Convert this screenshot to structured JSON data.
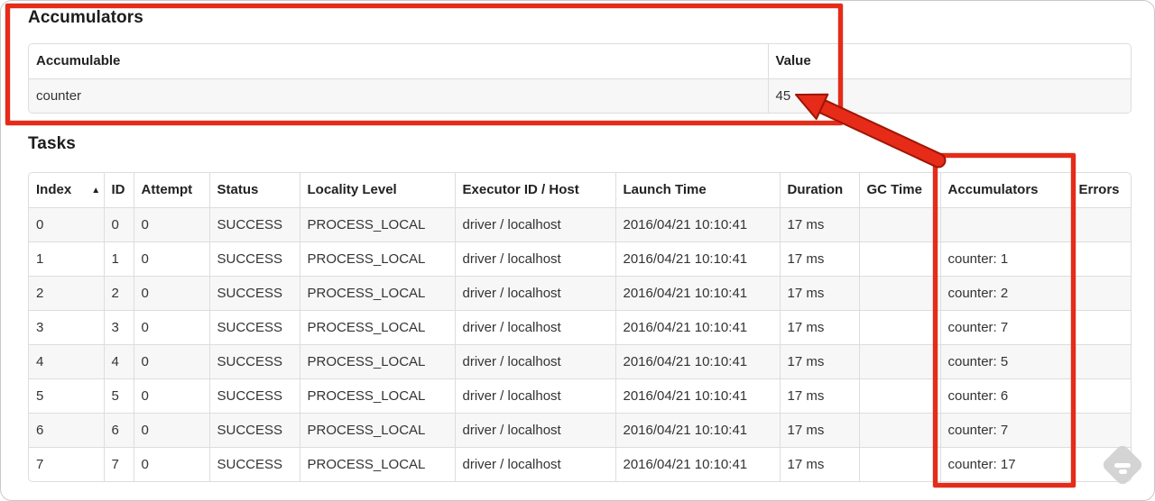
{
  "colors": {
    "annotation_red": "#e62b18",
    "row_stripe": "#f7f7f7",
    "table_border": "#dddddd"
  },
  "accumulators_section": {
    "title": "Accumulators",
    "table": {
      "headers": [
        "Accumulable",
        "Value"
      ],
      "rows": [
        [
          "counter",
          "45"
        ]
      ]
    }
  },
  "tasks_section": {
    "title": "Tasks",
    "sort_indicator": "▲",
    "table": {
      "headers": [
        "Index",
        "ID",
        "Attempt",
        "Status",
        "Locality Level",
        "Executor ID / Host",
        "Launch Time",
        "Duration",
        "GC Time",
        "Accumulators",
        "Errors"
      ],
      "rows": [
        [
          "0",
          "0",
          "0",
          "SUCCESS",
          "PROCESS_LOCAL",
          "driver / localhost",
          "2016/04/21 10:10:41",
          "17 ms",
          "",
          "",
          ""
        ],
        [
          "1",
          "1",
          "0",
          "SUCCESS",
          "PROCESS_LOCAL",
          "driver / localhost",
          "2016/04/21 10:10:41",
          "17 ms",
          "",
          "counter: 1",
          ""
        ],
        [
          "2",
          "2",
          "0",
          "SUCCESS",
          "PROCESS_LOCAL",
          "driver / localhost",
          "2016/04/21 10:10:41",
          "17 ms",
          "",
          "counter: 2",
          ""
        ],
        [
          "3",
          "3",
          "0",
          "SUCCESS",
          "PROCESS_LOCAL",
          "driver / localhost",
          "2016/04/21 10:10:41",
          "17 ms",
          "",
          "counter: 7",
          ""
        ],
        [
          "4",
          "4",
          "0",
          "SUCCESS",
          "PROCESS_LOCAL",
          "driver / localhost",
          "2016/04/21 10:10:41",
          "17 ms",
          "",
          "counter: 5",
          ""
        ],
        [
          "5",
          "5",
          "0",
          "SUCCESS",
          "PROCESS_LOCAL",
          "driver / localhost",
          "2016/04/21 10:10:41",
          "17 ms",
          "",
          "counter: 6",
          ""
        ],
        [
          "6",
          "6",
          "0",
          "SUCCESS",
          "PROCESS_LOCAL",
          "driver / localhost",
          "2016/04/21 10:10:41",
          "17 ms",
          "",
          "counter: 7",
          ""
        ],
        [
          "7",
          "7",
          "0",
          "SUCCESS",
          "PROCESS_LOCAL",
          "driver / localhost",
          "2016/04/21 10:10:41",
          "17 ms",
          "",
          "counter: 17",
          ""
        ]
      ]
    }
  },
  "watermark_icon": "feedly-logo"
}
